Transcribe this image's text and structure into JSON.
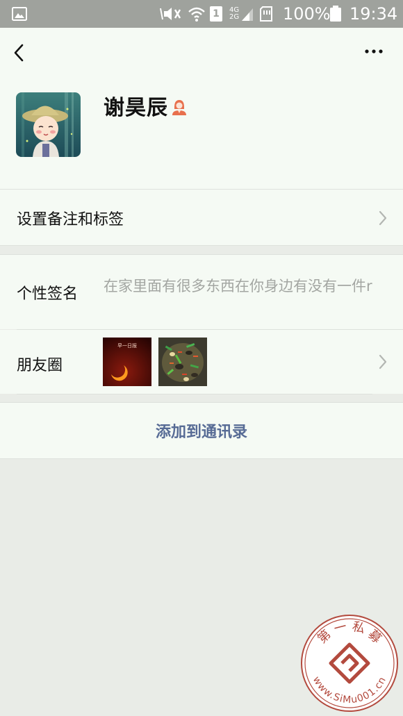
{
  "status_bar": {
    "battery_percent": "100%",
    "time": "19:34",
    "sim_slot": "1",
    "network_upper": "4G",
    "network_lower": "2G",
    "icons": [
      "image-icon",
      "mute-icon",
      "wifi-icon",
      "sim-icon",
      "signal-icon",
      "memory-card-icon",
      "battery-icon"
    ]
  },
  "header": {
    "back_icon": "chevron-left-icon",
    "more_icon": "more-dots-icon"
  },
  "profile": {
    "name": "谢昊辰",
    "gender_icon": "female-person-icon"
  },
  "remark_row": {
    "label": "设置备注和标签"
  },
  "signature_row": {
    "label": "个性签名",
    "value": "在家里面有很多东西在你身边有没有一件r"
  },
  "moments_row": {
    "label": "朋友圈",
    "thumbnail_1_text": "早一日报"
  },
  "add_contact": {
    "label": "添加到通讯录"
  },
  "watermark": {
    "top_text": "第 一 私 募",
    "bottom_text": "www.SiMu001.cn"
  },
  "colors": {
    "page_background": "#e9ece7",
    "card_background": "#f5faf4",
    "status_bar": "#9fa29d",
    "link_blue": "#576b95",
    "gender_icon": "#e8704d",
    "watermark": "#b34a3e"
  }
}
